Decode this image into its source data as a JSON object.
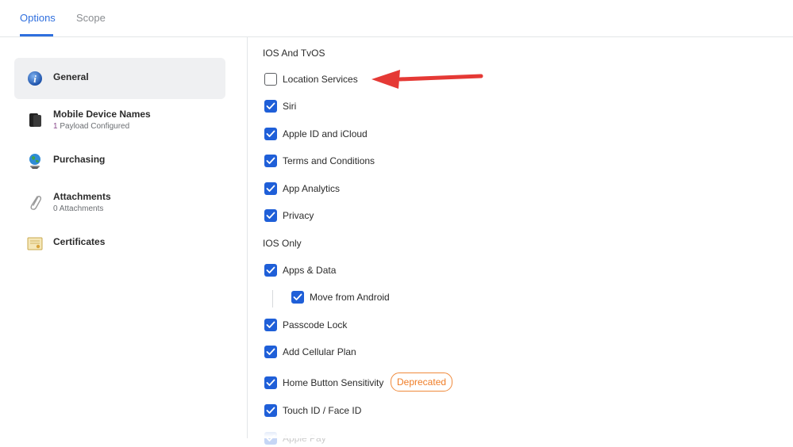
{
  "tabs": [
    {
      "label": "Options"
    },
    {
      "label": "Scope"
    }
  ],
  "sidebar": {
    "items": [
      {
        "title": "General",
        "icon": "info-icon"
      },
      {
        "title": "Mobile Device Names",
        "sub_count": "1",
        "sub_text": " Payload Configured",
        "icon": "device-icon"
      },
      {
        "title": "Purchasing",
        "icon": "globe-icon"
      },
      {
        "title": "Attachments",
        "sub_count": "0",
        "sub_text": " Attachments",
        "icon": "paperclip-icon"
      },
      {
        "title": "Certificates",
        "icon": "certificate-icon"
      }
    ]
  },
  "sections": {
    "ios_tvos": "IOS And TvOS",
    "ios_only": "IOS Only"
  },
  "options": {
    "location_services": "Location Services",
    "siri": "Siri",
    "apple_id": "Apple ID and iCloud",
    "terms": "Terms and Conditions",
    "app_analytics": "App Analytics",
    "privacy": "Privacy",
    "apps_data": "Apps & Data",
    "move_android": "Move from Android",
    "passcode_lock": "Passcode Lock",
    "cellular_plan": "Add Cellular Plan",
    "home_button": "Home Button Sensitivity",
    "touch_id": "Touch ID / Face ID",
    "apple_pay": "Apple Pay"
  },
  "checked": {
    "location_services": false,
    "siri": true,
    "apple_id": true,
    "terms": true,
    "app_analytics": true,
    "privacy": true,
    "apps_data": true,
    "move_android": true,
    "passcode_lock": true,
    "cellular_plan": true,
    "home_button": true,
    "touch_id": true
  },
  "badges": {
    "deprecated": "Deprecated"
  },
  "colors": {
    "accent": "#1f5fd8",
    "tab_active": "#2f6fde",
    "badge": "#f07d26",
    "arrow": "#e53935"
  }
}
